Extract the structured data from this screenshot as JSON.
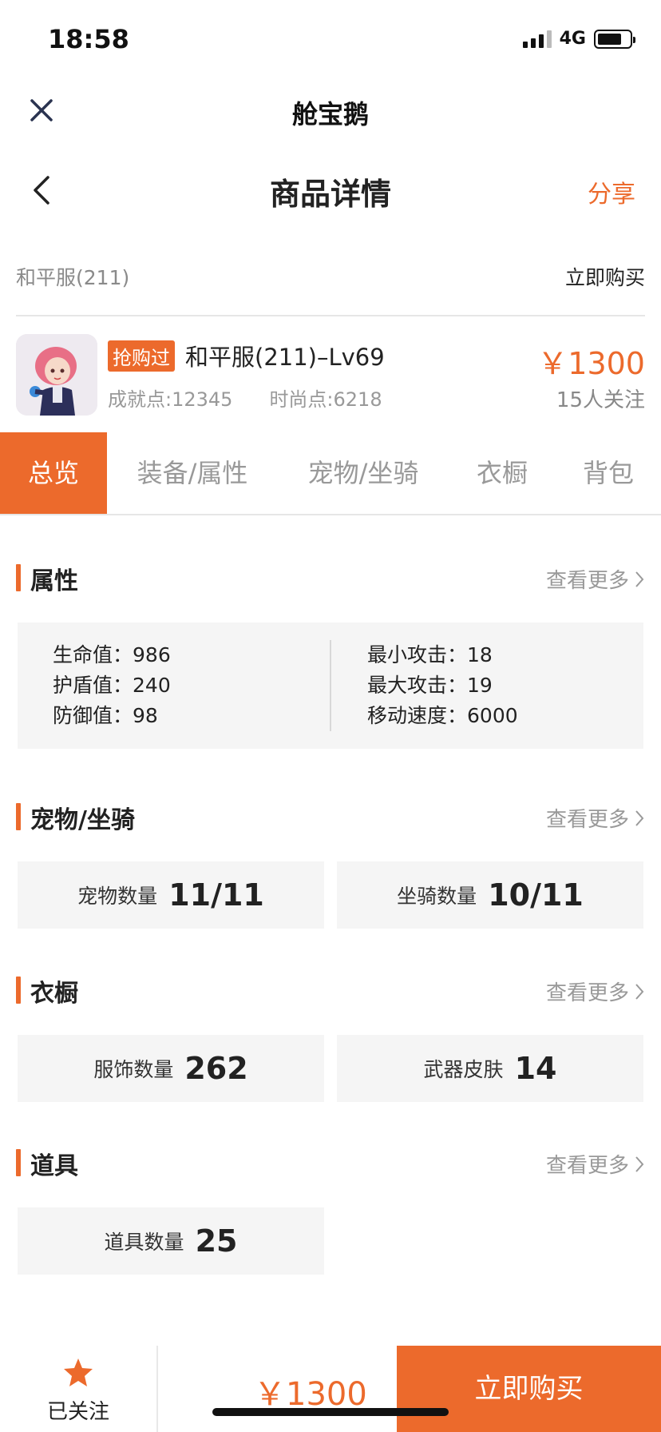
{
  "status": {
    "time": "18:58",
    "network": "4G",
    "battery_level": 0.75
  },
  "mini_header": {
    "title": "舱宝鹅"
  },
  "nav": {
    "title": "商品详情",
    "share": "分享"
  },
  "server_row": {
    "server": "和平服(211)",
    "buy_now": "立即购买"
  },
  "product": {
    "badge": "抢购过",
    "name": "和平服(211)–Lv69",
    "achievement": "成就点:12345",
    "fashion": "时尚点:6218",
    "price": "￥1300",
    "followers": "15人关注"
  },
  "tabs": [
    {
      "label": "总览",
      "active": true
    },
    {
      "label": "装备/属性",
      "active": false
    },
    {
      "label": "宠物/坐骑",
      "active": false
    },
    {
      "label": "衣橱",
      "active": false
    },
    {
      "label": "背包",
      "active": false
    }
  ],
  "more_label": "查看更多",
  "attributes": {
    "title": "属性",
    "left": [
      {
        "label": "生命值：",
        "value": "986"
      },
      {
        "label": "护盾值：",
        "value": "240"
      },
      {
        "label": "防御值：",
        "value": "98"
      }
    ],
    "right": [
      {
        "label": "最小攻击：",
        "value": "18"
      },
      {
        "label": "最大攻击：",
        "value": "19"
      },
      {
        "label": "移动速度：",
        "value": "6000"
      }
    ]
  },
  "pets": {
    "title": "宠物/坐骑",
    "items": [
      {
        "label": "宠物数量",
        "value": "11/11"
      },
      {
        "label": "坐骑数量",
        "value": "10/11"
      }
    ]
  },
  "wardrobe": {
    "title": "衣橱",
    "items": [
      {
        "label": "服饰数量",
        "value": "262"
      },
      {
        "label": "武器皮肤",
        "value": "14"
      }
    ]
  },
  "props": {
    "title": "道具",
    "items": [
      {
        "label": "道具数量",
        "value": "25"
      }
    ]
  },
  "bottom": {
    "follow_label": "已关注",
    "price": "￥1300",
    "buy_label": "立即购买"
  },
  "colors": {
    "accent": "#ec6a2c",
    "panel": "#f5f5f5",
    "muted": "#999999"
  }
}
